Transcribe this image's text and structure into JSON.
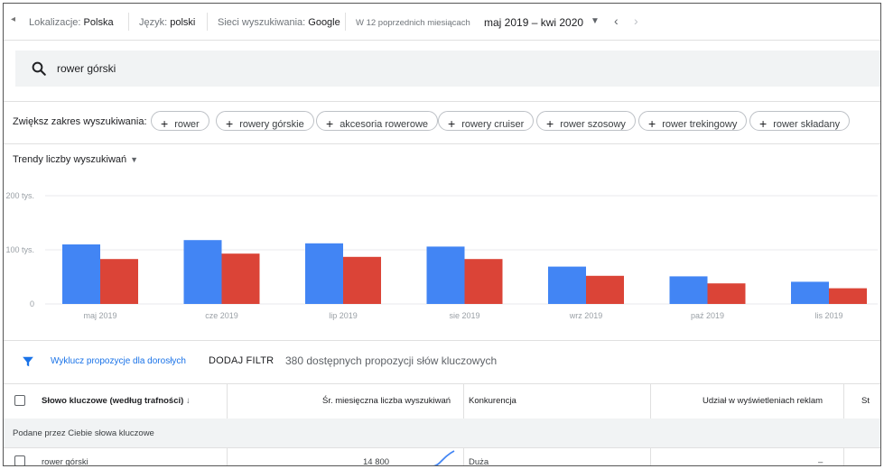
{
  "topbar": {
    "location_label": "Lokalizacje:",
    "location_value": "Polska",
    "language_label": "Język:",
    "language_value": "polski",
    "network_label": "Sieci wyszukiwania:",
    "network_value": "Google",
    "period_label": "W 12 poprzednich miesiącach",
    "period_value": "maj 2019 – kwi 2020",
    "prev_label": "‹",
    "next_label": "›",
    "back_label": "◂"
  },
  "search": {
    "query": "rower górski"
  },
  "broaden": {
    "label": "Zwiększ zakres wyszukiwania:",
    "chips": [
      "rower",
      "rowery górskie",
      "akcesoria rowerowe",
      "rowery cruiser",
      "rower szosowy",
      "rower trekingowy",
      "rower składany"
    ]
  },
  "trend": {
    "title": "Trendy liczby wyszukiwań",
    "colors": {
      "series1": "#4285f4",
      "series2": "#db4437",
      "grid": "#e8eaed"
    }
  },
  "chart_data": {
    "type": "bar",
    "categories": [
      "maj 2019",
      "cze 2019",
      "lip 2019",
      "sie 2019",
      "wrz 2019",
      "paź 2019",
      "lis 2019"
    ],
    "series": [
      {
        "values": [
          110000,
          118000,
          112000,
          106000,
          69000,
          51000,
          41000
        ]
      },
      {
        "values": [
          83000,
          93000,
          87000,
          83000,
          52000,
          38000,
          29000
        ]
      }
    ],
    "yticks": [
      {
        "value": 0,
        "label": "0"
      },
      {
        "value": 100000,
        "label": "100 tys."
      },
      {
        "value": 200000,
        "label": "200 tys."
      }
    ],
    "ylim": [
      0,
      200000
    ],
    "grid": true,
    "title": "",
    "xlabel": "",
    "ylabel": ""
  },
  "filters": {
    "exclude_adult": "Wyklucz propozycje dla dorosłych",
    "add_filter": "DODAJ FILTR",
    "count": "380 dostępnych propozycji słów kluczowych"
  },
  "table": {
    "headers": {
      "keyword": "Słowo kluczowe (według trafności)",
      "sort_icon": "↓",
      "avg_searches": "Śr. miesięczna liczba wyszukiwań",
      "competition": "Konkurencja",
      "impression_share": "Udział w wyświetleniach reklam",
      "next": "St"
    },
    "section_label": "Podane przez Ciebie słowa kluczowe",
    "rows": [
      {
        "keyword": "rower górski",
        "avg_searches": "14 800",
        "competition": "Duża",
        "impression_share": "–"
      }
    ]
  }
}
